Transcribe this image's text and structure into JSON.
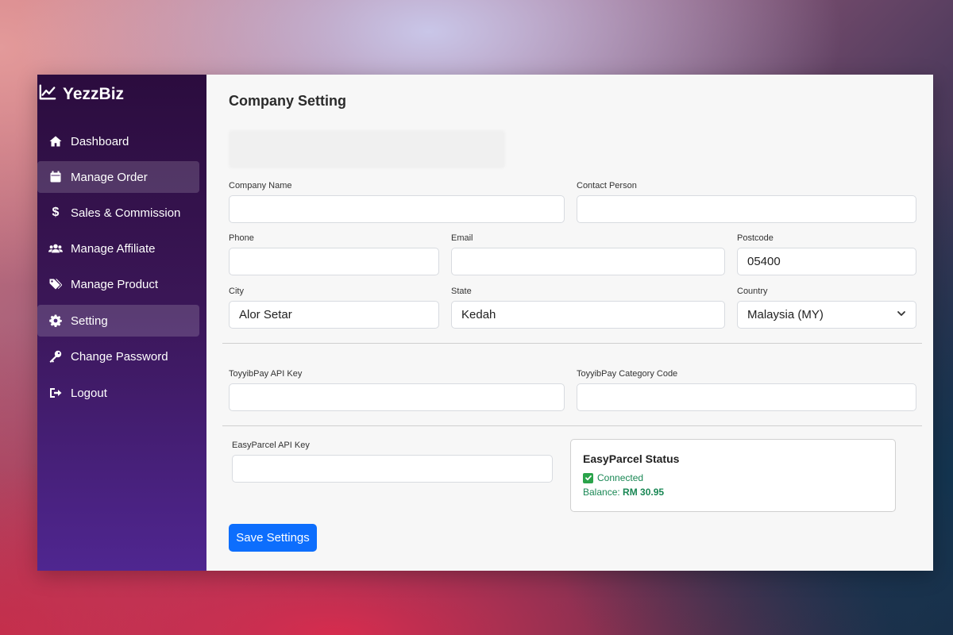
{
  "brand": {
    "name": "YezzBiz",
    "icon": "chart-line-icon"
  },
  "sidebar": {
    "items": [
      {
        "label": "Dashboard",
        "icon": "home-icon",
        "active": false
      },
      {
        "label": "Manage Order",
        "icon": "calendar-icon",
        "active": true
      },
      {
        "label": "Sales & Commission",
        "icon": "dollar-icon",
        "active": false
      },
      {
        "label": "Manage Affiliate",
        "icon": "users-icon",
        "active": false
      },
      {
        "label": "Manage Product",
        "icon": "tags-icon",
        "active": false
      },
      {
        "label": "Setting",
        "icon": "gear-icon",
        "active": true
      },
      {
        "label": "Change Password",
        "icon": "key-icon",
        "active": false
      },
      {
        "label": "Logout",
        "icon": "logout-icon",
        "active": false
      }
    ]
  },
  "page": {
    "title": "Company Setting"
  },
  "form": {
    "company_name": {
      "label": "Company Name",
      "value": ""
    },
    "contact_person": {
      "label": "Contact Person",
      "value": ""
    },
    "phone": {
      "label": "Phone",
      "value": ""
    },
    "email": {
      "label": "Email",
      "value": ""
    },
    "postcode": {
      "label": "Postcode",
      "value": "05400"
    },
    "city": {
      "label": "City",
      "value": "Alor Setar"
    },
    "state": {
      "label": "State",
      "value": "Kedah"
    },
    "country": {
      "label": "Country",
      "value": "Malaysia (MY)"
    },
    "toyyibpay_api_key": {
      "label": "ToyyibPay API Key",
      "value": ""
    },
    "toyyibpay_category_code": {
      "label": "ToyyibPay Category Code",
      "value": ""
    },
    "easyparcel_api_key": {
      "label": "EasyParcel API Key",
      "value": ""
    }
  },
  "easyparcel_status": {
    "title": "EasyParcel Status",
    "status": "Connected",
    "balance_label": "Balance:",
    "balance_value": "RM 30.95"
  },
  "actions": {
    "save_label": "Save Settings"
  },
  "colors": {
    "primary": "#0d6efd",
    "success": "#198754",
    "sidebar_top": "#2b0c3e",
    "sidebar_bottom": "#4f2690"
  }
}
